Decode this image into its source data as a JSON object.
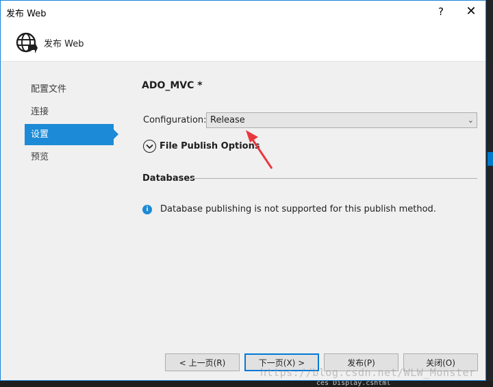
{
  "window": {
    "title": "发布 Web",
    "help_glyph": "?",
    "close_glyph": "✕"
  },
  "header": {
    "title": "发布 Web",
    "icon": "globe-arrow-icon"
  },
  "nav": {
    "items": [
      {
        "label": "配置文件",
        "active": false
      },
      {
        "label": "连接",
        "active": false
      },
      {
        "label": "设置",
        "active": true
      },
      {
        "label": "预览",
        "active": false
      }
    ]
  },
  "main": {
    "profile_name": "ADO_MVC *",
    "configuration": {
      "label": "Configuration:",
      "value": "Release"
    },
    "file_publish_options": "File Publish Options",
    "databases": {
      "title": "Databases",
      "info": "Database publishing is not supported for this publish method."
    }
  },
  "buttons": {
    "prev": "< 上一页(R)",
    "next": "下一页(X) >",
    "publish": "发布(P)",
    "close": "关闭(O)"
  },
  "background": {
    "bottom_text": "ces Display.cshtml"
  },
  "watermark": "https://blog.csdn.net/WLW_Monster",
  "colors": {
    "accent": "#1c8ad6",
    "annotation_arrow": "#e8383d"
  }
}
